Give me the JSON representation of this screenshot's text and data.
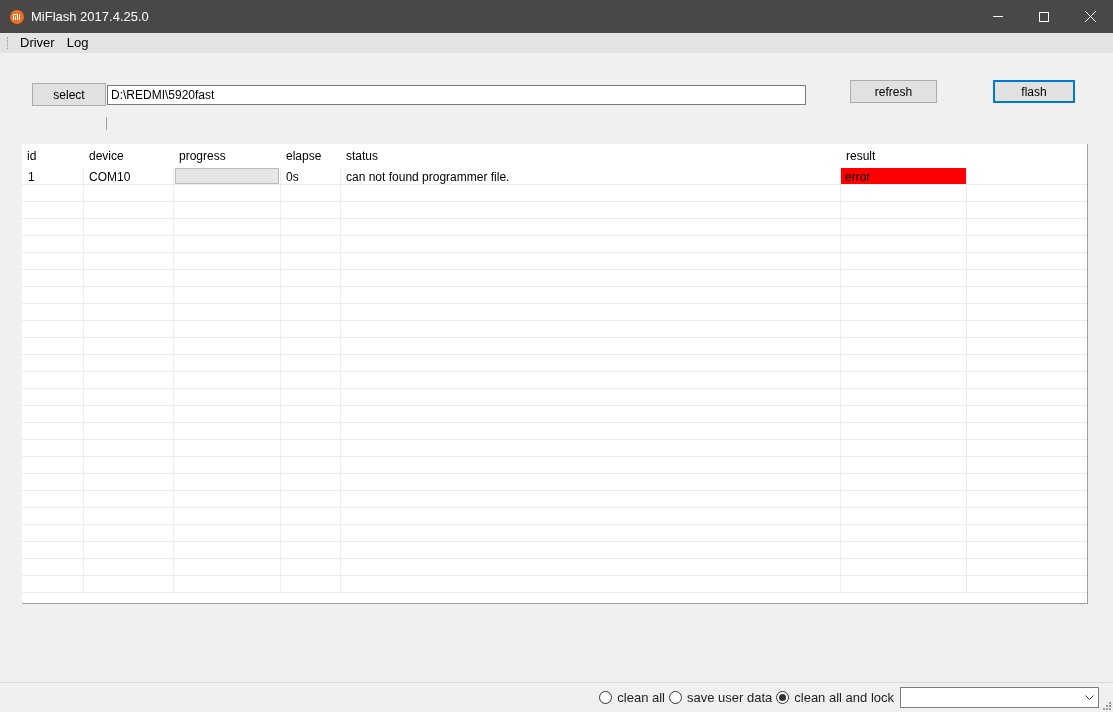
{
  "window": {
    "title": "MiFlash 2017.4.25.0"
  },
  "menu": [
    "Driver",
    "Log"
  ],
  "select_button": "select",
  "path_field": {
    "value": "D:\\REDMI\\5920fast"
  },
  "refresh_button": "refresh",
  "flash_button": {
    "label": "flash",
    "focused": true
  },
  "table": {
    "columns": [
      "id",
      "device",
      "progress",
      "elapse",
      "status",
      "result"
    ],
    "rows": [
      {
        "id": "1",
        "device": "COM10",
        "progress": {
          "level": 0
        },
        "elapse": "0s",
        "status": "can not found programmer file.",
        "result": "error",
        "color": "#ff0000"
      }
    ]
  },
  "options": [
    {
      "label": "clean all",
      "selected": false
    },
    {
      "label": "save user data",
      "selected": false
    },
    {
      "label": "clean all and lock",
      "selected": true
    }
  ]
}
